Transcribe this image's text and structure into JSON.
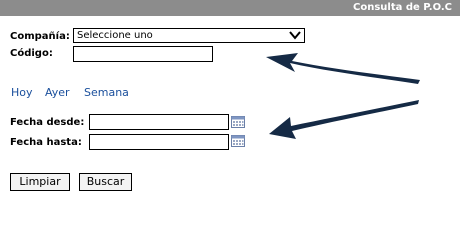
{
  "header": {
    "title": "Consulta de P.O.C"
  },
  "form": {
    "company_label": "Compañía:",
    "company_selected": "Seleccione uno",
    "code_label": "Código:",
    "code_value": "",
    "date_from_label": "Fecha desde:",
    "date_from_value": "",
    "date_to_label": "Fecha hasta:",
    "date_to_value": ""
  },
  "quick_links": {
    "today": "Hoy",
    "yesterday": "Ayer",
    "week": "Semana"
  },
  "buttons": {
    "clear": "Limpiar",
    "search": "Buscar"
  },
  "colors": {
    "header_bg": "#8c8c8c",
    "link": "#1a4f9c",
    "arrow": "#152a45"
  },
  "icons": {
    "dropdown": "chevron-down-icon",
    "calendar": "calendar-icon",
    "annotation": "arrow-icon"
  }
}
